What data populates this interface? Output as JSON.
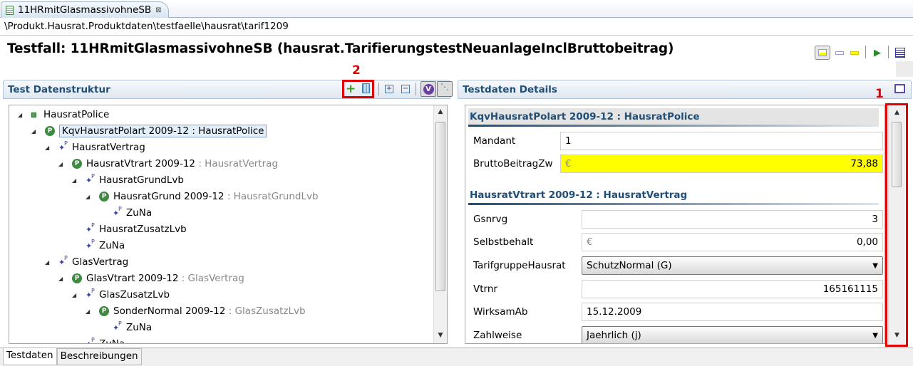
{
  "editor_tab": {
    "title": "11HRmitGlasmassivohneSB",
    "close": "⊠"
  },
  "breadcrumb": "\\Produkt.Hausrat.Produktdaten\\testfaelle\\hausrat\\tarif1209",
  "page_title": "Testfall: 11HRmitGlasmassivohneSB (hausrat.TarifierungstestNeuanlageInclBruttobeitrag)",
  "annotations": {
    "one": "1",
    "two": "2"
  },
  "left_panel": {
    "title": "Test Datenstruktur",
    "tree": [
      {
        "label": "HausratPolice",
        "type": "",
        "icon": "root"
      },
      {
        "label": "KqvHausratPolart 2009-12 : HausratPolice",
        "type": "",
        "icon": "p"
      },
      {
        "label": "HausratVertrag",
        "type": "",
        "icon": "link"
      },
      {
        "label": "HausratVtrart 2009-12",
        "type": " : HausratVertrag",
        "icon": "p"
      },
      {
        "label": "HausratGrundLvb",
        "type": "",
        "icon": "link"
      },
      {
        "label": "HausratGrund 2009-12",
        "type": " : HausratGrundLvb",
        "icon": "p"
      },
      {
        "label": "ZuNa",
        "type": "",
        "icon": "link"
      },
      {
        "label": "HausratZusatzLvb",
        "type": "",
        "icon": "link"
      },
      {
        "label": "ZuNa",
        "type": "",
        "icon": "link"
      },
      {
        "label": "GlasVertrag",
        "type": "",
        "icon": "link"
      },
      {
        "label": "GlasVtrart 2009-12",
        "type": " : GlasVertrag",
        "icon": "p"
      },
      {
        "label": "GlasZusatzLvb",
        "type": "",
        "icon": "link"
      },
      {
        "label": "SonderNormal 2009-12",
        "type": " : GlasZusatzLvb",
        "icon": "p"
      },
      {
        "label": "ZuNa",
        "type": "",
        "icon": "link"
      },
      {
        "label": "ZuNa",
        "type": "",
        "icon": "link"
      }
    ]
  },
  "right_panel": {
    "title": "Testdaten Details",
    "section1": "KqvHausratPolart 2009-12 : HausratPolice",
    "section2": "HausratVtrart 2009-12 : HausratVertrag",
    "fields": {
      "mandant": {
        "label": "Mandant",
        "value": "1"
      },
      "brutto": {
        "label": "BruttoBeitragZw",
        "currency": "€",
        "value": "73,88"
      },
      "gsnrvg": {
        "label": "Gsnrvg",
        "value": "3"
      },
      "selbst": {
        "label": "Selbstbehalt",
        "currency": "€",
        "value": "0,00"
      },
      "tarif": {
        "label": "TarifgruppeHausrat",
        "value": "SchutzNormal (G)"
      },
      "vtrnr": {
        "label": "Vtrnr",
        "value": "165161115"
      },
      "wirksam": {
        "label": "WirksamAb",
        "value": "15.12.2009"
      },
      "zahlweise": {
        "label": "Zahlweise",
        "value": "Jaehrlich (j)"
      }
    }
  },
  "bottom_tabs": [
    "Testdaten",
    "Beschreibungen"
  ],
  "colors": {
    "highlight": "#ffff00",
    "annotation": "#e00000",
    "header_text": "#1f4e79"
  }
}
